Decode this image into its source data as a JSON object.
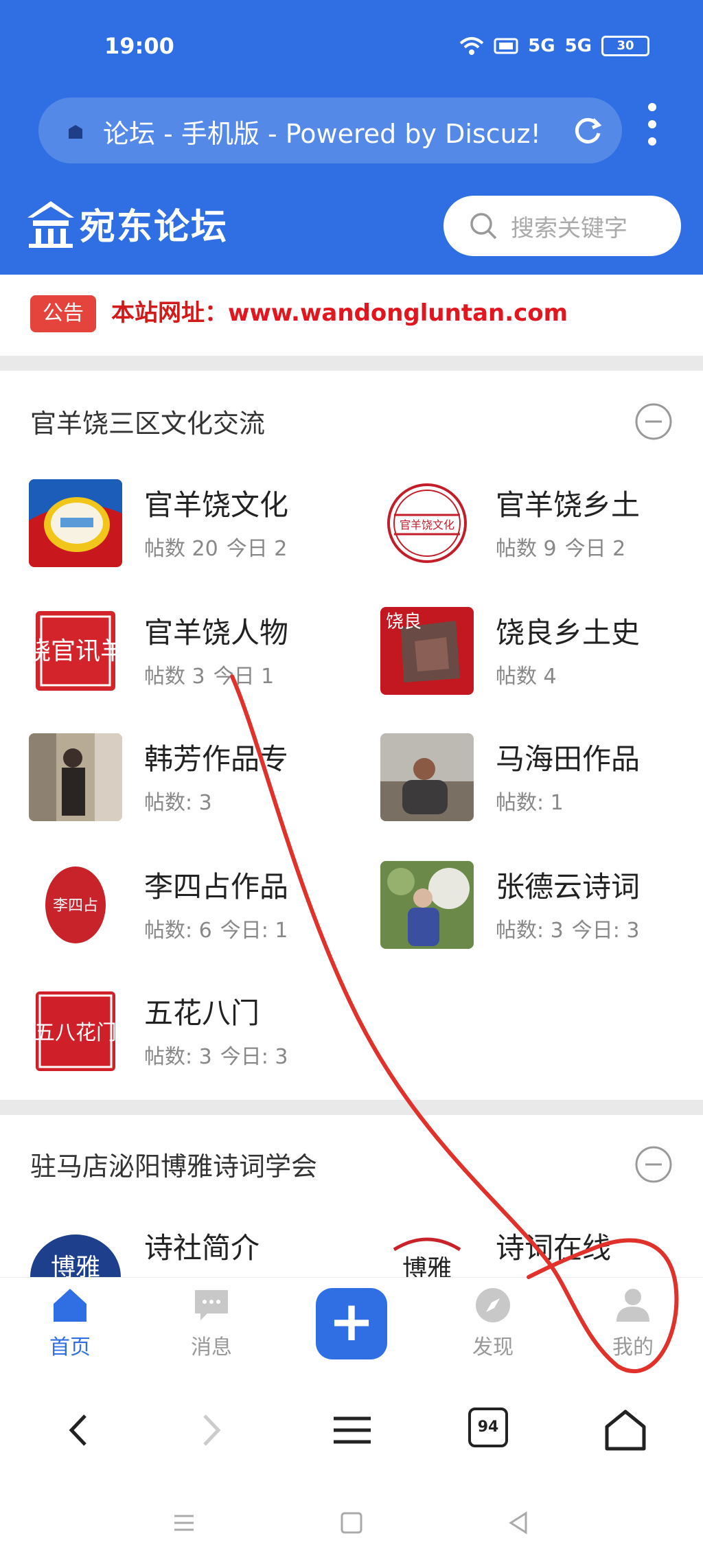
{
  "status_bar": {
    "time": "19:00",
    "signal1": "5G",
    "signal2": "5G",
    "battery": "30"
  },
  "browser": {
    "page_title": "论坛 - 手机版 - Powered by Discuz!",
    "tab_count": "94"
  },
  "header": {
    "logo_text": "宛东论坛",
    "search_placeholder": "搜索关键字"
  },
  "notice": {
    "badge": "公告",
    "label": "本站网址：",
    "url": "www.wandongluntan.com"
  },
  "sections": [
    {
      "title": "官羊饶三区文化交流",
      "forums": [
        {
          "name": "官羊饶文化",
          "stats": "帖数 20",
          "today": "今日 2"
        },
        {
          "name": "官羊饶乡土",
          "stats": "帖数 9",
          "today": "今日 2"
        },
        {
          "name": "官羊饶人物",
          "stats": "帖数 3",
          "today": "今日 1"
        },
        {
          "name": "饶良乡土史",
          "stats": "帖数 4",
          "today": ""
        },
        {
          "name": "韩芳作品专",
          "stats": "帖数: 3",
          "today": ""
        },
        {
          "name": "马海田作品",
          "stats": "帖数: 1",
          "today": ""
        },
        {
          "name": "李四占作品",
          "stats": "帖数: 6",
          "today": "今日: 1"
        },
        {
          "name": "张德云诗词",
          "stats": "帖数: 3",
          "today": "今日: 3"
        },
        {
          "name": "五花八门",
          "stats": "帖数: 3",
          "today": "今日: 3"
        }
      ]
    },
    {
      "title": "驻马店泌阳博雅诗词学会",
      "forums": [
        {
          "name": "诗社简介",
          "stats": "",
          "today": ""
        },
        {
          "name": "诗词在线",
          "stats": "",
          "today": ""
        }
      ]
    }
  ],
  "thumb_text": {
    "guanyangrao_ren": "饶官讯羊",
    "raoliang": "饶良",
    "lisizhan": "李四占",
    "wuhua": "五八花门",
    "boya": "博雅",
    "xiangtu": "官羊饶文化"
  },
  "tabbar": {
    "home": "首页",
    "messages": "消息",
    "discover": "发现",
    "mine": "我的"
  },
  "colors": {
    "brand_blue": "#2f6fe3",
    "notice_red": "#e1161f",
    "annotation_red": "#e0312a"
  }
}
